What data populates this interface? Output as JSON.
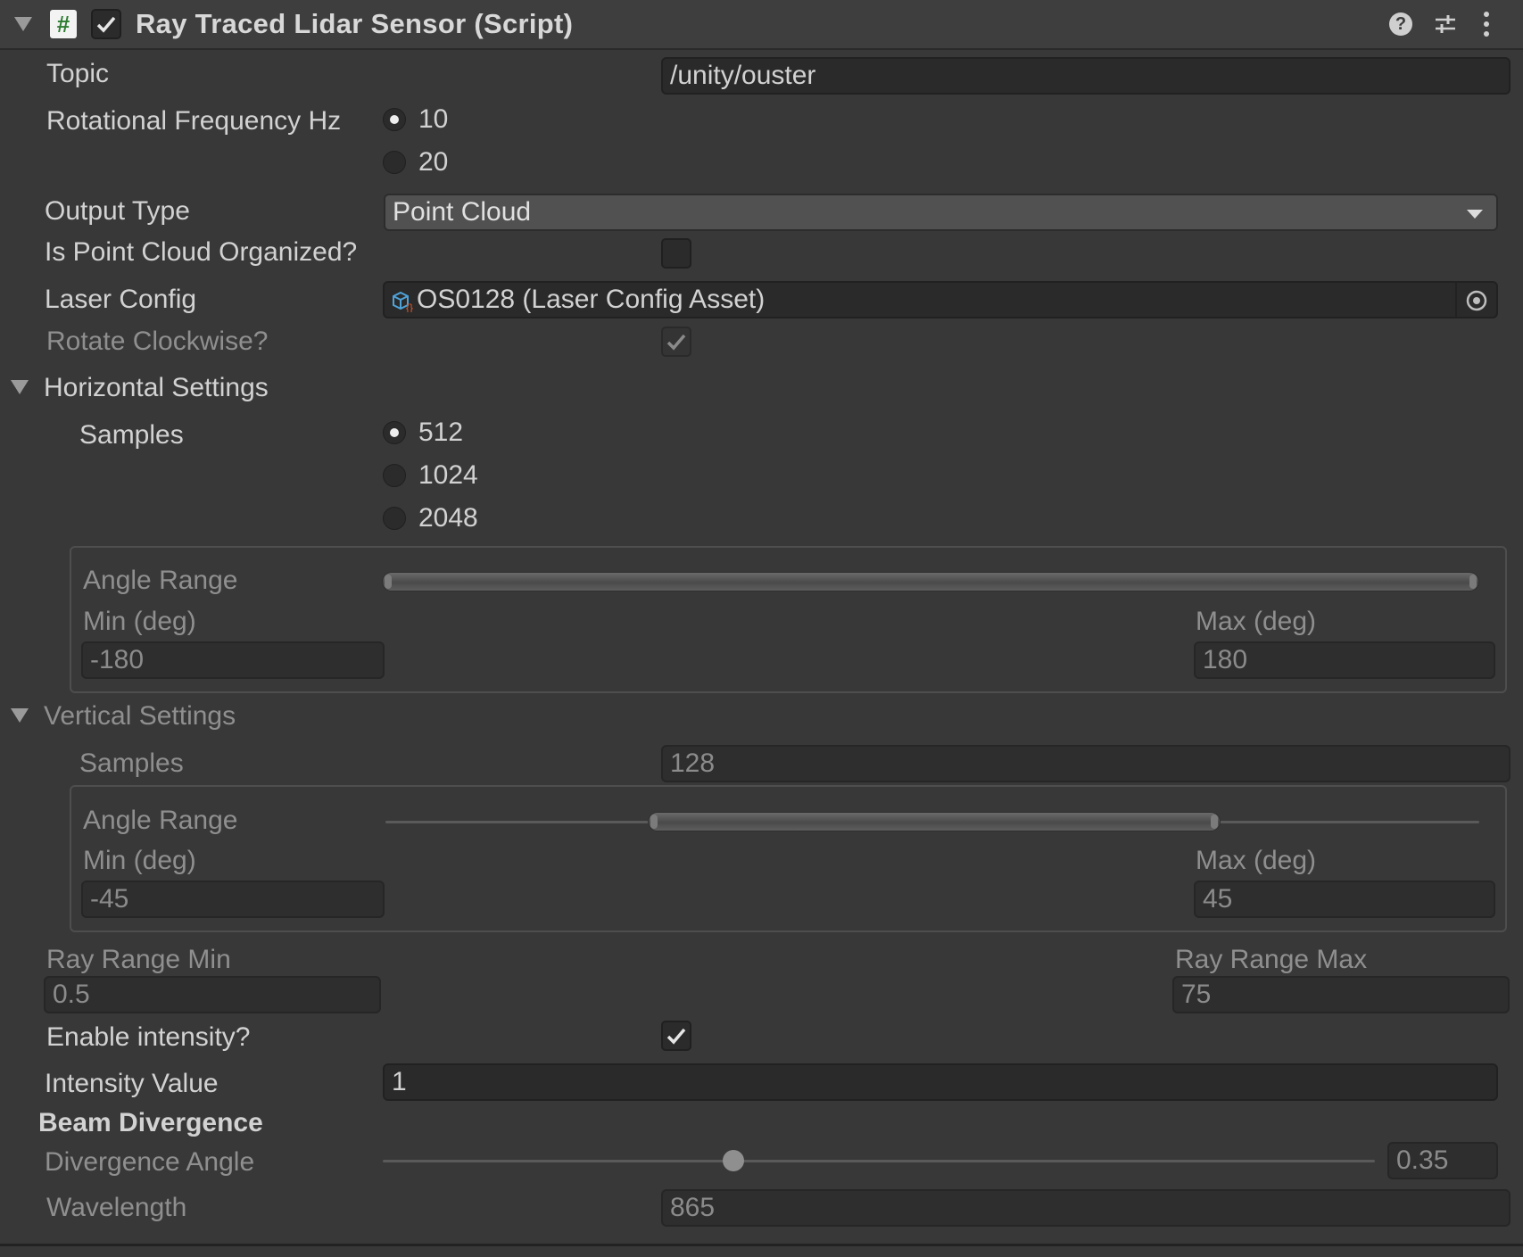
{
  "header": {
    "title": "Ray Traced Lidar Sensor (Script)",
    "script_icon_glyph": "#",
    "enabled": true
  },
  "fields": {
    "topic": {
      "label": "Topic",
      "value": "/unity/ouster"
    },
    "rotational_frequency": {
      "label": "Rotational Frequency Hz",
      "options": [
        "10",
        "20"
      ],
      "selected": "10"
    },
    "output_type": {
      "label": "Output Type",
      "value": "Point Cloud"
    },
    "organized": {
      "label": "Is Point Cloud Organized?",
      "checked": false
    },
    "laser_config": {
      "label": "Laser Config",
      "value": "OS0128 (Laser Config Asset)"
    },
    "rotate_clockwise": {
      "label": "Rotate Clockwise?",
      "checked": true
    }
  },
  "horizontal": {
    "title": "Horizontal Settings",
    "samples_label": "Samples",
    "sample_options": [
      "512",
      "1024",
      "2048"
    ],
    "selected": "512",
    "angle_range_label": "Angle Range",
    "min_label": "Min (deg)",
    "max_label": "Max (deg)",
    "min": "-180",
    "max": "180"
  },
  "vertical": {
    "title": "Vertical Settings",
    "samples_label": "Samples",
    "samples": "128",
    "angle_range_label": "Angle Range",
    "min_label": "Min (deg)",
    "max_label": "Max (deg)",
    "min": "-45",
    "max": "45"
  },
  "ray_range": {
    "min_label": "Ray Range Min",
    "min": "0.5",
    "max_label": "Ray Range Max",
    "max": "75"
  },
  "intensity": {
    "enable_label": "Enable intensity?",
    "enabled": true,
    "value_label": "Intensity Value",
    "value": "1"
  },
  "beam": {
    "title": "Beam Divergence",
    "angle_label": "Divergence Angle",
    "angle": "0.35",
    "wavelength_label": "Wavelength",
    "wavelength": "865"
  },
  "colors": {
    "background": "#383838",
    "field": "#2a2a2a",
    "script_icon": "#2e7d32",
    "asset_icon": "#4fa3d9"
  }
}
